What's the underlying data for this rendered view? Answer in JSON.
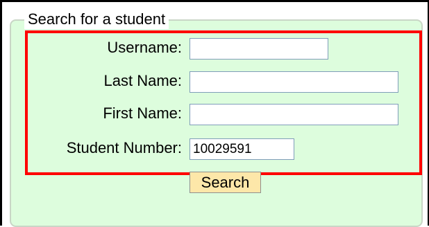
{
  "form": {
    "legend": "Search for a student",
    "fields": {
      "username": {
        "label": "Username:",
        "value": ""
      },
      "last_name": {
        "label": "Last Name:",
        "value": ""
      },
      "first_name": {
        "label": "First Name:",
        "value": ""
      },
      "student_number": {
        "label": "Student Number:",
        "value": "10029591"
      }
    },
    "search_button": "Search"
  },
  "colors": {
    "panel_background": "#ddfddd",
    "highlight_border": "#ff0000",
    "button_background": "#fde7a9"
  }
}
